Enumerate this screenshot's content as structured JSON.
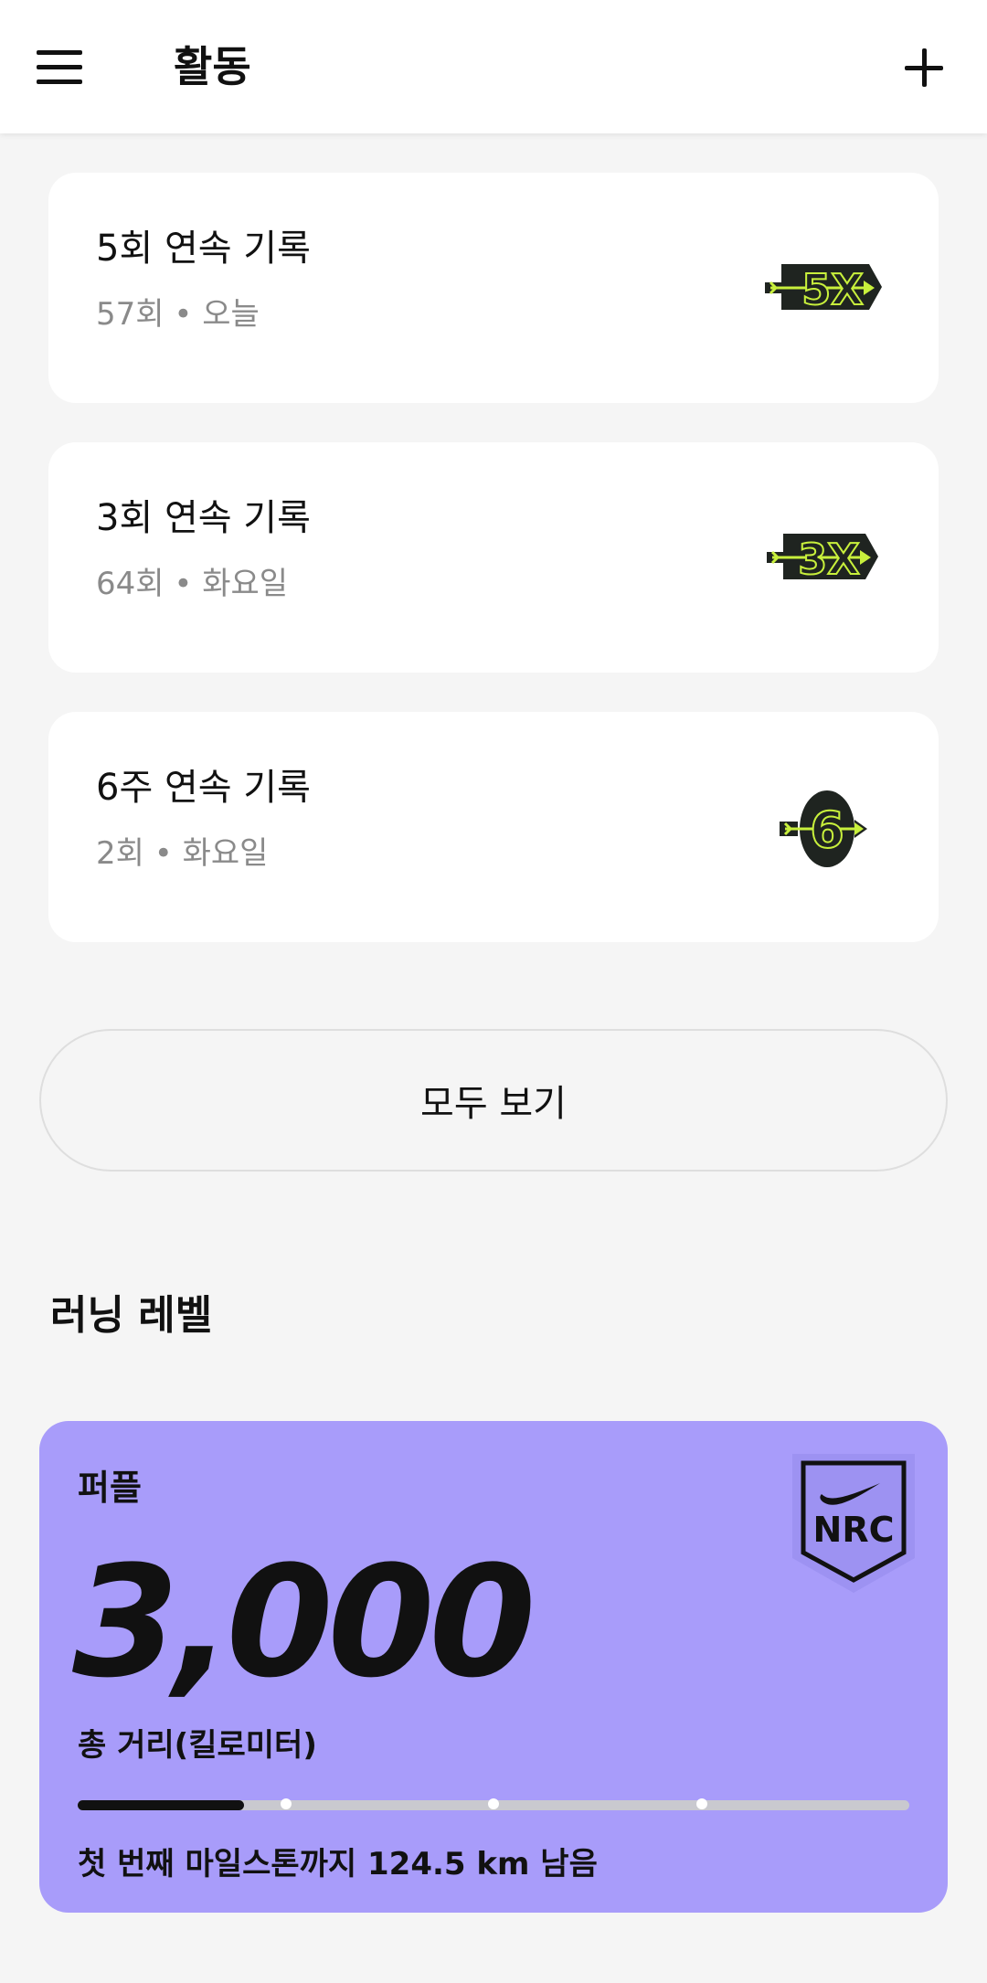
{
  "app_bar": {
    "title": "활동",
    "menu_icon": "hamburger-menu-icon",
    "add_icon": "plus-icon"
  },
  "streaks": [
    {
      "title": "5회 연속 기록",
      "subtitle": "57회 • 오늘",
      "badge_text": "5X",
      "badge_icon": "streak-5x-badge-icon"
    },
    {
      "title": "3회 연속 기록",
      "subtitle": "64회 • 화요일",
      "badge_text": "3X",
      "badge_icon": "streak-3x-badge-icon"
    },
    {
      "title": "6주 연속 기록",
      "subtitle": "2회 • 화요일",
      "badge_text": "6",
      "badge_icon": "streak-6-badge-icon"
    }
  ],
  "see_all_label": "모두 보기",
  "running_level": {
    "section_title": "러닝 레벨",
    "level_name": "퍼플",
    "value": "3,000",
    "unit_label": "총 거리(킬로미터)",
    "remaining_text": "첫 번째 마일스톤까지 124.5 km 남음",
    "progress_fraction": 0.2,
    "milestone_fractions": [
      0.25,
      0.5,
      0.75
    ],
    "badge_text": "NRC",
    "badge_icon": "nrc-badge-icon"
  },
  "colors": {
    "level_card": "#a89cfa",
    "badge_neon": "#c8f03c",
    "badge_dark": "#1f2420"
  }
}
